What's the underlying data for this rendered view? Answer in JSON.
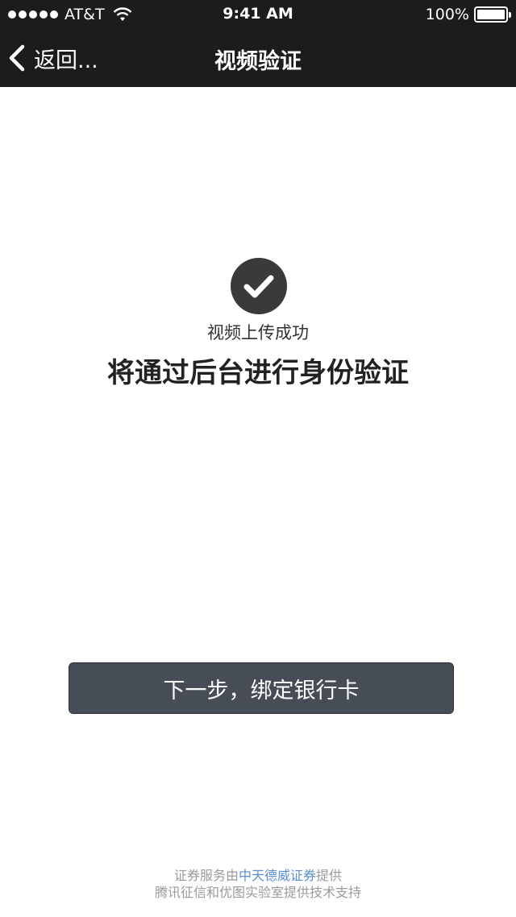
{
  "status_bar": {
    "carrier": "AT&T",
    "time": "9:41 AM",
    "battery": "100%",
    "signal_bars": 5,
    "battery_level": 1.0
  },
  "nav": {
    "back_label": "返回...",
    "title": "视频验证"
  },
  "result": {
    "upload_message": "视频上传成功",
    "verify_message": "将通过后台进行身份验证",
    "icon": "check-circle-icon"
  },
  "actions": {
    "next_label": "下一步，绑定银行卡"
  },
  "footer": {
    "line1_prefix": "证券服务由",
    "line1_link": "中天德威证券",
    "line1_suffix": "提供",
    "line2": "腾讯征信和优图实验室提供技术支持"
  },
  "colors": {
    "header_bg": "#1c1c1e",
    "button_bg": "#474d57",
    "icon_bg": "#3a3a3c",
    "link": "#5b8fd1",
    "footer_text": "#9a9a9a"
  }
}
